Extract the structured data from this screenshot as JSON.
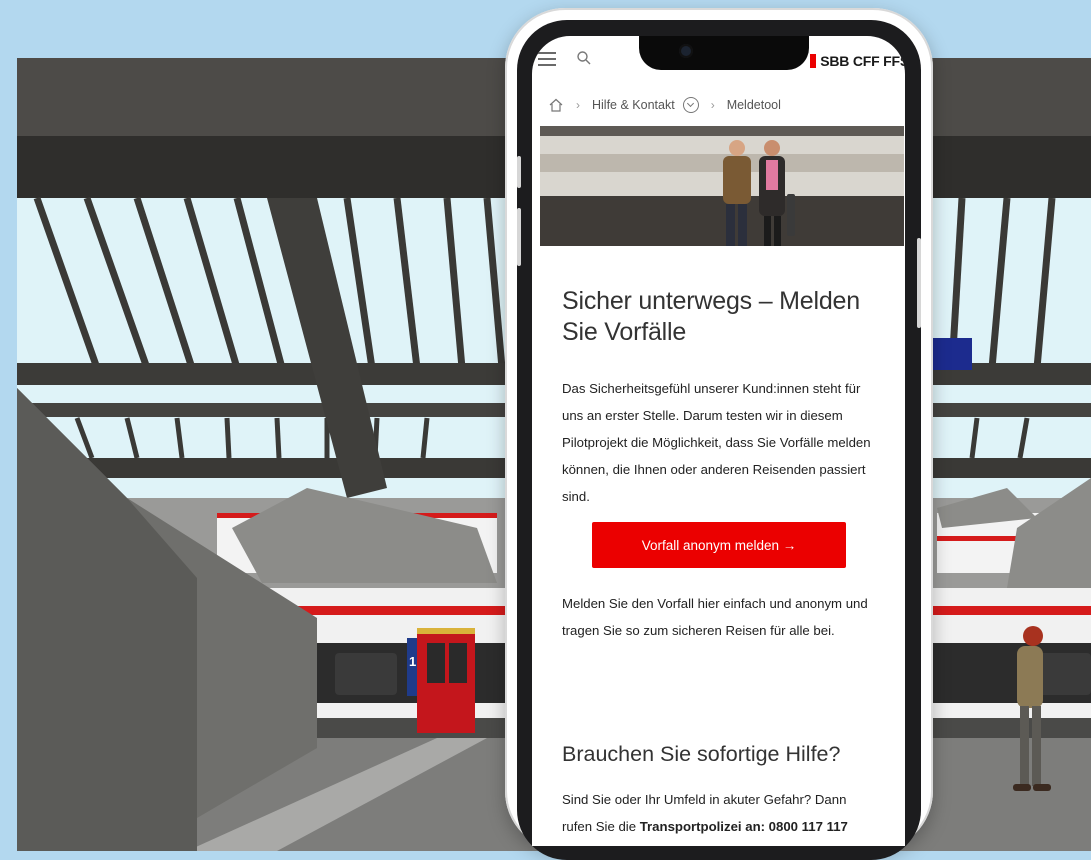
{
  "site": {
    "brand_name": "SBB CFF FFS",
    "brand_color": "#eb0000"
  },
  "breadcrumb": {
    "items": [
      "Hilfe & Kontakt",
      "Meldetool"
    ]
  },
  "page": {
    "title": "Sicher unterwegs – Melden Sie Vorfälle",
    "intro": "Das Sicherheitsgefühl unserer Kund:innen steht für uns an erster Stelle. Darum testen wir in diesem Pilotprojekt die Möglichkeit, dass Sie Vorfälle melden können, die Ihnen oder anderen Reisenden passiert sind.",
    "cta_label": "Vorfall anonym melden  →",
    "body": "Melden Sie den Vorfall hier einfach und anonym und tragen Sie so zum sicheren Reisen für alle bei.",
    "help_heading": "Brauchen Sie sofortige Hilfe?",
    "help_text_line1": "Sind Sie oder Ihr Umfeld in akuter Gefahr? Dann",
    "help_text_line2_prefix": "rufen Sie die ",
    "help_text_line2_bold": "Transportpolizei an: 0800 117 117"
  },
  "illustration": {
    "wagon_number": "1"
  },
  "icons": [
    "menu-icon",
    "search-icon",
    "home-icon",
    "chevron-right-icon",
    "chevron-down-icon",
    "arrow-right-icon",
    "camera-icon"
  ]
}
